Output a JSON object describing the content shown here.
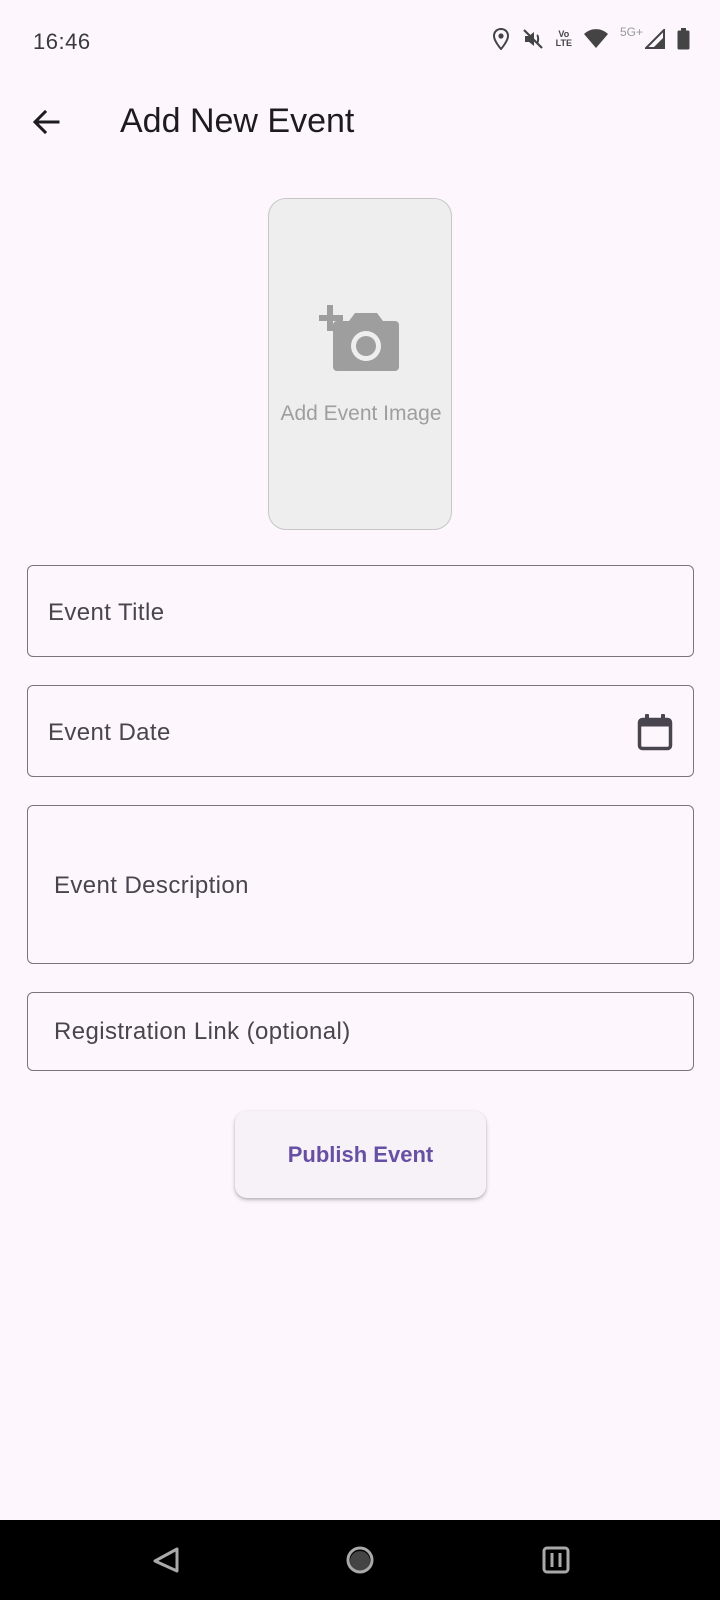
{
  "status_bar": {
    "time": "16:46",
    "icons": [
      "location-icon",
      "mute-icon",
      "volte-icon",
      "wifi-icon",
      "5g-icon",
      "signal-icon",
      "battery-icon"
    ],
    "volte_line1": "Vo",
    "volte_line2": "LTE",
    "network_label": "5G+"
  },
  "app_bar": {
    "title": "Add New Event",
    "back_icon": "arrow-back-icon"
  },
  "image_picker": {
    "label": "Add Event Image",
    "icon": "add-camera-icon"
  },
  "form": {
    "title_placeholder": "Event Title",
    "date_placeholder": "Event Date",
    "date_icon": "calendar-icon",
    "description_placeholder": "Event Description",
    "link_placeholder": "Registration Link (optional)"
  },
  "actions": {
    "publish_label": "Publish Event"
  },
  "colors": {
    "background": "#fdf7fd",
    "accent": "#6750a4",
    "outline": "#79747e",
    "image_placeholder_bg": "#eeeeee"
  },
  "nav_bar": {
    "items": [
      "back-nav-icon",
      "home-nav-icon",
      "recents-nav-icon"
    ]
  }
}
